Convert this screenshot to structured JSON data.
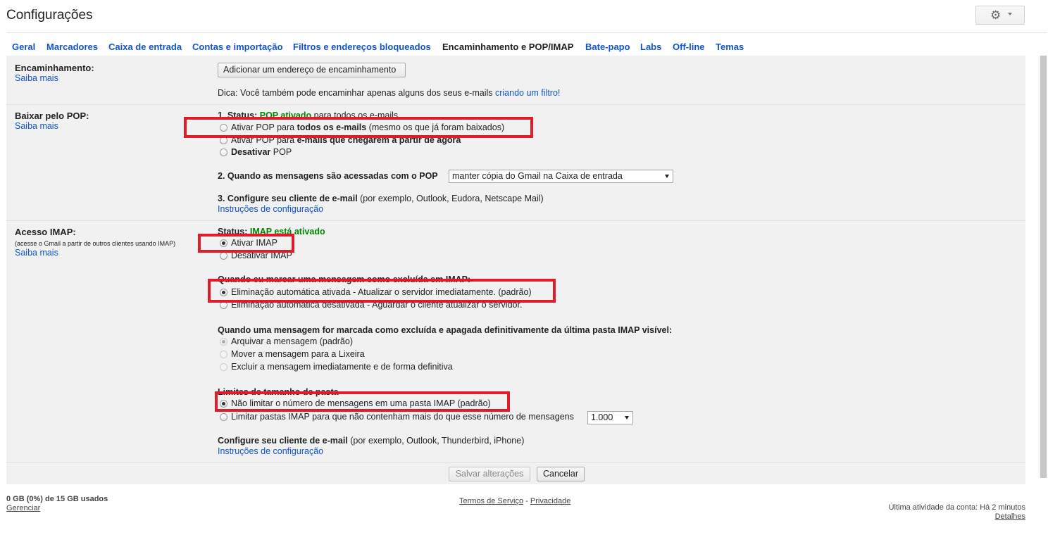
{
  "page_title": "Configurações",
  "tabs": [
    "Geral",
    "Marcadores",
    "Caixa de entrada",
    "Contas e importação",
    "Filtros e endereços bloqueados",
    "Encaminhamento e POP/IMAP",
    "Bate-papo",
    "Labs",
    "Off-line",
    "Temas"
  ],
  "active_tab": "Encaminhamento e POP/IMAP",
  "gear_icon": "gear-icon",
  "forwarding": {
    "label": "Encaminhamento:",
    "learn_more": "Saiba mais",
    "add_button": "Adicionar um endereço de encaminhamento",
    "tip_prefix": "Dica: Você também pode encaminhar apenas alguns dos seus e-mails ",
    "tip_link": "criando um filtro!"
  },
  "pop": {
    "label": "Baixar pelo POP:",
    "learn_more": "Saiba mais",
    "status_label": "1. Status:",
    "status_value": "POP ativado",
    "status_suffix": "para todos os e-mails",
    "opt1_prefix": "Ativar POP para ",
    "opt1_bold": "todos os e-mails",
    "opt1_suffix": " (mesmo os que já foram baixados)",
    "opt2_prefix": "Ativar POP para ",
    "opt2_bold": "e-mails que chegarem a partir de agora",
    "opt3_bold": "Desativar",
    "opt3_suffix": " POP",
    "access_label": "2. Quando as mensagens são acessadas com o POP",
    "access_select": "manter cópia do Gmail na Caixa de entrada",
    "config_label": "3. Configure seu cliente de e-mail",
    "config_examples": " (por exemplo, Outlook, Eudora, Netscape Mail)",
    "config_link": "Instruções de configuração"
  },
  "imap": {
    "label": "Acesso IMAP:",
    "sublabel": "(acesse o Gmail a partir de outros clientes usando IMAP)",
    "learn_more": "Saiba mais",
    "status_label": "Status:",
    "status_value": "IMAP está ativado",
    "enable": "Ativar IMAP",
    "disable": "Desativar IMAP",
    "deleted_heading": "Quando eu marcar uma mensagem como excluída em IMAP:",
    "expunge_on": "Eliminação automática ativada - Atualizar o servidor imediatamente. (padrão)",
    "expunge_off": "Eliminação automática desativada - Aguardar o cliente atualizar o servidor.",
    "expunged_heading": "Quando uma mensagem for marcada como excluída e apagada definitivamente da última pasta IMAP visível:",
    "archive": "Arquivar a mensagem (padrão)",
    "trash": "Mover a mensagem para a Lixeira",
    "delete_forever": "Excluir a mensagem imediatamente e de forma definitiva",
    "folder_heading": "Limites de tamanho de pasta",
    "no_limit": "Não limitar o número de mensagens em uma pasta IMAP (padrão)",
    "limit": "Limitar pastas IMAP para que não contenham mais do que esse número de mensagens",
    "limit_select": "1.000",
    "config_label": "Configure seu cliente de e-mail",
    "config_examples": " (por exemplo, Outlook, Thunderbird, iPhone)",
    "config_link": "Instruções de configuração"
  },
  "actions": {
    "save": "Salvar alterações",
    "cancel": "Cancelar"
  },
  "footer": {
    "storage": "0 GB (0%) de 15 GB usados",
    "manage": "Gerenciar",
    "terms": "Termos de Serviço",
    "sep": " - ",
    "privacy": "Privacidade",
    "last_activity": "Última atividade da conta: Há 2 minutos",
    "details": "Detalhes"
  },
  "colors": {
    "link": "#1155cc",
    "status_green": "#008800",
    "highlight_red": "#e21b2a",
    "panel_bg": "#f1f1f1"
  }
}
